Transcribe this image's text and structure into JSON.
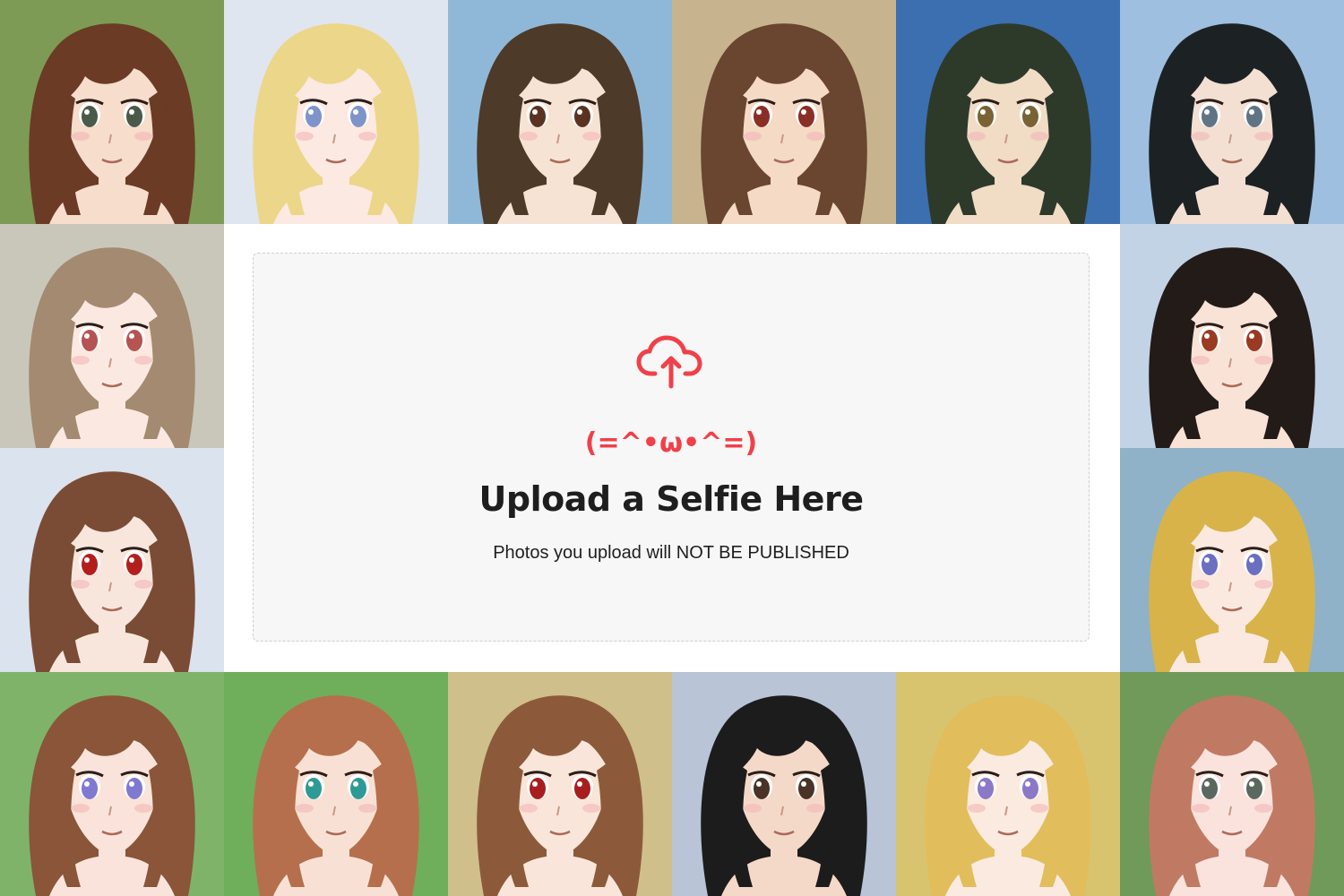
{
  "upload": {
    "icon": "cloud-upload-icon",
    "kaomoji": "(=^•ω•^=)",
    "title": "Upload a Selfie Here",
    "subtitle": "Photos you upload will NOT BE PUBLISHED"
  },
  "colors": {
    "accent": "#f0404a",
    "text": "#1e1e1e",
    "dropzone_bg": "#f7f7f7",
    "dropzone_border": "#cfcfcf"
  },
  "gallery": {
    "portraits": [
      {
        "name": "anime-portrait-1",
        "bg": "#7d9b55",
        "hair": "#6b3b25",
        "skin": "#f6ddcc",
        "eye": "#4a5a4a"
      },
      {
        "name": "anime-portrait-2",
        "bg": "#dfe6ef",
        "hair": "#ecd68a",
        "skin": "#fbe9e2",
        "eye": "#7e93c9"
      },
      {
        "name": "anime-portrait-3",
        "bg": "#8fb8d8",
        "hair": "#4e3a28",
        "skin": "#f7e3d3",
        "eye": "#5b3222"
      },
      {
        "name": "anime-portrait-4",
        "bg": "#c7b48e",
        "hair": "#6a4530",
        "skin": "#f5dac5",
        "eye": "#8a2f25"
      },
      {
        "name": "anime-portrait-5",
        "bg": "#3c6fb0",
        "hair": "#2d3a2a",
        "skin": "#f1dcc6",
        "eye": "#7a6333"
      },
      {
        "name": "anime-portrait-6",
        "bg": "#9fbfe0",
        "hair": "#1c2224",
        "skin": "#f3e0d3",
        "eye": "#5f7585"
      },
      {
        "name": "anime-portrait-7",
        "bg": "#c9c7b9",
        "hair": "#a38a70",
        "skin": "#fbe8e0",
        "eye": "#b65353"
      },
      {
        "name": "anime-portrait-8",
        "bg": "#c3d3e6",
        "hair": "#231b18",
        "skin": "#f8e3d6",
        "eye": "#9a3a22"
      },
      {
        "name": "anime-portrait-9",
        "bg": "#dbe3ee",
        "hair": "#7a4c35",
        "skin": "#f8e6dc",
        "eye": "#b3201c"
      },
      {
        "name": "anime-portrait-10",
        "bg": "#8fb2c8",
        "hair": "#d8b34a",
        "skin": "#fbe9df",
        "eye": "#6a6fc0"
      },
      {
        "name": "anime-portrait-11",
        "bg": "#7fb36a",
        "hair": "#8a5538",
        "skin": "#f9e3da",
        "eye": "#7f79d0"
      },
      {
        "name": "anime-portrait-12",
        "bg": "#6fae5a",
        "hair": "#b66f4c",
        "skin": "#f8e1d4",
        "eye": "#2e9a95"
      },
      {
        "name": "anime-portrait-13",
        "bg": "#cfbf8b",
        "hair": "#8c5a3a",
        "skin": "#f9e5d9",
        "eye": "#a81e1e"
      },
      {
        "name": "anime-portrait-14",
        "bg": "#b9c4d6",
        "hair": "#1d1c1c",
        "skin": "#f4d9c8",
        "eye": "#4a3227"
      },
      {
        "name": "anime-portrait-15",
        "bg": "#d8c46e",
        "hair": "#e2bd5c",
        "skin": "#fbeadf",
        "eye": "#8b78c6"
      },
      {
        "name": "anime-portrait-16",
        "bg": "#6f9a5a",
        "hair": "#c07a64",
        "skin": "#f9e3dc",
        "eye": "#5b6860"
      }
    ]
  }
}
